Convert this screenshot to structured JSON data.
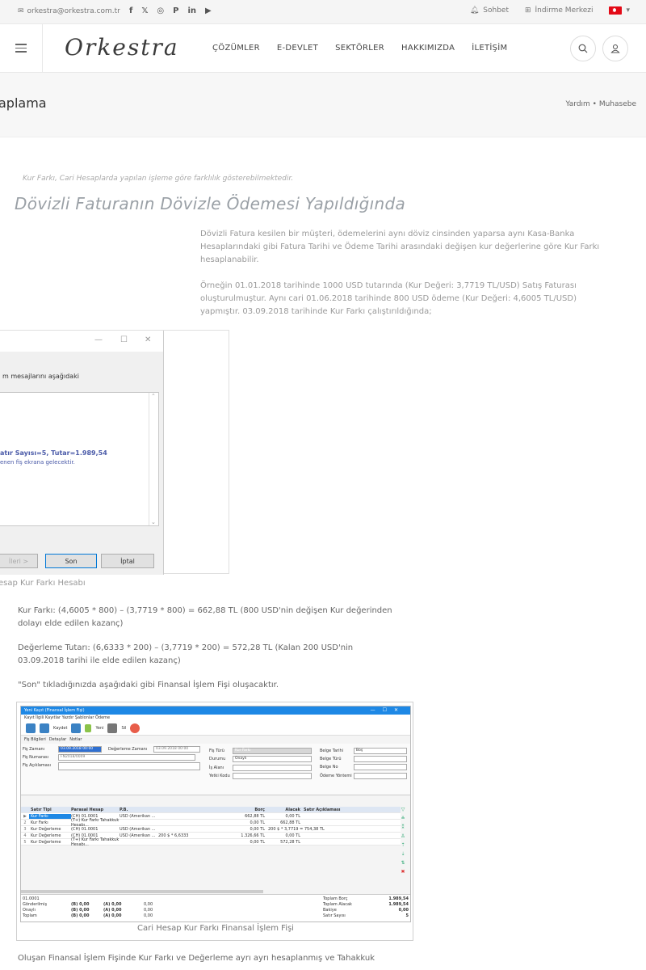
{
  "topbar": {
    "email": "orkestra@orkestra.com.tr",
    "social_icons": [
      "facebook-icon",
      "twitter-icon",
      "instagram-icon",
      "pinterest-icon",
      "linkedin-icon",
      "youtube-icon"
    ],
    "social_glyphs": [
      "f",
      "𝕏",
      "◎",
      "P",
      "in",
      "▶"
    ],
    "chat_label": "Sohbet",
    "download_label": "İndirme Merkezi",
    "language": "TR"
  },
  "header": {
    "logo": "Orkestra",
    "nav": [
      "ÇÖZÜMLER",
      "E-DEVLET",
      "SEKTÖRLER",
      "HAKKIMIZDA",
      "İLETİŞİM"
    ]
  },
  "page": {
    "title": "aplama",
    "breadcrumb": "Yardım • Muhasebe"
  },
  "content": {
    "note": "Kur Farkı, Cari Hesaplarda yapılan işleme göre farklılık gösterebilmektedir.",
    "heading": "Dövizli Faturanın Dövizle Ödemesi Yapıldığında",
    "p1": "Dövizli Fatura kesilen bir müşteri, ödemelerini aynı döviz cinsinden yaparsa aynı Kasa-Banka Hesaplarındaki gibi Fatura Tarihi ve Ödeme Tarihi arasındaki değişen kur değerlerine göre Kur Farkı hesaplanabilir.",
    "p2": "Örneğin 01.01.2018 tarihinde 1000 USD tutarında (Kur Değeri: 3,7719 TL/USD) Satış Faturası oluşturulmuştur. Aynı cari 01.06.2018 tarihinde 800 USD ödeme (Kur Değeri: 4,6005 TL/USD) yapmıştır. 03.09.2018 tarihinde Kur Farkı çalıştırıldığında;",
    "wizard": {
      "message": "m mesajlarını aşağıdaki",
      "result_line": "atır Sayısı=5, Tutar=1.989,54",
      "result_sub": "enen fiş ekrana gelecektir.",
      "next": "İleri >",
      "finish": "Son",
      "cancel": "İptal",
      "caption": "esap Kur Farkı Hesabı"
    },
    "p3": "Kur Farkı: (4,6005 * 800) – (3,7719 * 800) = 662,88 TL (800 USD'nin değişen Kur değerinden dolayı elde edilen kazanç)",
    "p4": "Değerleme Tutarı: (6,6333 * 200) – (3,7719 * 200) = 572,28 TL (Kalan 200 USD'nin 03.09.2018 tarihi ile elde edilen kazanç)",
    "p5": "\"Son\" tıkladığınızda aşağıdaki gibi Finansal İşlem Fişi oluşacaktır.",
    "fis": {
      "window_title": "Yeni Kayıt (Finansal İşlem Fişi)",
      "menu": "Kayıt   İlgili Kayıtlar   Yazdır   Şablonlar   Ödeme",
      "toolbar": [
        "Kaydet",
        "Yeni",
        "Sil"
      ],
      "tabs": [
        "Fiş Bilgileri",
        "Detaylar",
        "Notlar"
      ],
      "fields": {
        "fis_zamani": "Fiş Zamanı",
        "fis_zamani_val": "03.09.2018 00:00",
        "degerleme_label": "Değerleme Zamanı",
        "degerleme_val": "03.09.2018 00:00",
        "fis_numarasi": "Fiş Numarası",
        "fis_numarasi_val": "FN2018/0009",
        "fis_aciklamasi": "Fiş Açıklaması",
        "fis_turu": "Fiş Türü",
        "fis_turu_val": "Kur Farkı",
        "durumu": "Durumu",
        "durumu_val": "Onaylı",
        "is_alani": "İş Alanı",
        "yetki_kodu": "Yetki Kodu",
        "belge_tarihi": "Belge Tarihi",
        "belge_tarihi_val": "Boş",
        "belge_turu": "Belge Türü",
        "belge_no": "Belge No",
        "odeme_yontemi": "Ödeme Yöntemi"
      },
      "grid_headers": [
        "Satır Tipi",
        "Parasal Hesap",
        "P.B.",
        "",
        "Borç",
        "Alacak",
        "Satır Açıklaması"
      ],
      "rows": [
        {
          "n": "▶",
          "tip": "Kur Farkı",
          "hesap": "(CH) 01.0001",
          "pb": "USD (Amerikan ...",
          "kur": "",
          "borc": "662,88 TL",
          "alacak": "0,00 TL"
        },
        {
          "n": "2",
          "tip": "Kur Farkı",
          "hesap": "(T+) Kur Farkı Tahakkuk Hesabı...",
          "pb": "",
          "kur": "",
          "borc": "0,00 TL",
          "alacak": "662,88 TL"
        },
        {
          "n": "3",
          "tip": "Kur Değerleme",
          "hesap": "(CH) 01.0001",
          "pb": "USD (Amerikan ...",
          "kur": "",
          "borc": "0,00 TL",
          "alacak": "200 $ * 3,7719 = 754,38 TL"
        },
        {
          "n": "4",
          "tip": "Kur Değerleme",
          "hesap": "(CH) 01.0001",
          "pb": "USD (Amerikan ...",
          "kur": "200 $ * 6,6333",
          "borc": "1.326,66 TL",
          "alacak": "0,00 TL"
        },
        {
          "n": "5",
          "tip": "Kur Değerleme",
          "hesap": "(T+) Kur Farkı Tahakkuk Hesabı...",
          "pb": "",
          "kur": "",
          "borc": "0,00 TL",
          "alacak": "572,28 TL"
        }
      ],
      "totals_left": [
        {
          "label": "01.0001",
          "b": "",
          "a": "",
          "t": ""
        },
        {
          "label": "Gönderilmiş",
          "b": "(B) 0,00",
          "a": "(A) 0,00",
          "t": "0,00"
        },
        {
          "label": "Onaylı",
          "b": "(B) 0,00",
          "a": "(A) 0,00",
          "t": "0,00"
        },
        {
          "label": "Toplam",
          "b": "(B) 0,00",
          "a": "(A) 0,00",
          "t": "0,00"
        }
      ],
      "totals_right": [
        {
          "label": "Toplam Borç",
          "v": "1.989,54"
        },
        {
          "label": "Toplam Alacak",
          "v": "1.989,54"
        },
        {
          "label": "Bakiye",
          "v": "0,00"
        },
        {
          "label": "Satır Sayısı",
          "v": "5"
        }
      ],
      "caption": "Cari Hesap Kur Farkı Finansal İşlem Fişi"
    },
    "p6": "Oluşan Finansal İşlem Fişinde Kur Farkı ve Değerleme ayrı ayrı hesaplanmış ve Tahakkuk"
  }
}
